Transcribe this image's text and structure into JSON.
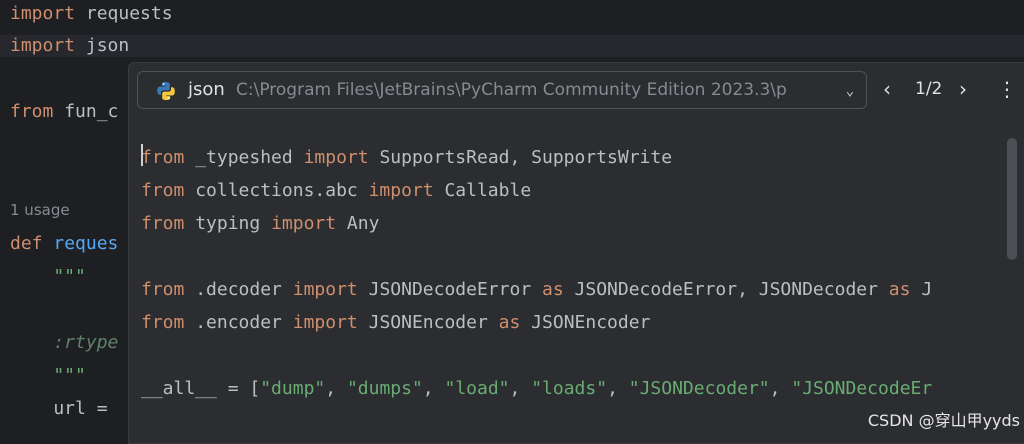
{
  "editor": {
    "lines": {
      "import_requests": [
        "import",
        " requests"
      ],
      "import_json": [
        "import",
        " json"
      ],
      "from_fun": [
        "from",
        " fun_c"
      ],
      "usage_hint": "1 usage",
      "def_line": [
        "def",
        " ",
        "reques"
      ],
      "doc_open": "    \"\"\"",
      "rtype": "    :rtype",
      "doc_close": "    \"\"\"",
      "url": "    url ="
    }
  },
  "popup": {
    "module_name": "json",
    "module_path": "C:\\Program Files\\JetBrains\\PyCharm Community Edition 2023.3\\p",
    "page_indicator": "1/2",
    "icons": {
      "module": "python-icon",
      "dropdown": "chevron-down-icon",
      "prev": "chevron-left-icon",
      "next": "chevron-right-icon",
      "more": "more-vertical-icon"
    },
    "code": {
      "l1": [
        "from",
        " _typeshed ",
        "import",
        " SupportsRead, SupportsWrite"
      ],
      "l2": [
        "from",
        " collections.abc ",
        "import",
        " Callable"
      ],
      "l3": [
        "from",
        " typing ",
        "import",
        " Any"
      ],
      "l4": [
        "from",
        " .decoder ",
        "import",
        " JSONDecodeError ",
        "as",
        " JSONDecodeError, JSONDecoder ",
        "as",
        " J"
      ],
      "l5": [
        "from",
        " .encoder ",
        "import",
        " JSONEncoder ",
        "as",
        " JSONEncoder"
      ],
      "l6": [
        "__all__ = [",
        "\"dump\"",
        ", ",
        "\"dumps\"",
        ", ",
        "\"load\"",
        ", ",
        "\"loads\"",
        ", ",
        "\"JSONDecoder\"",
        ", ",
        "\"JSONDecodeEr"
      ]
    }
  },
  "watermark": "CSDN @穿山甲yyds",
  "colors": {
    "background": "#1e1f22",
    "popup_background": "#2b2d30",
    "keyword": "#cf8e6d",
    "function": "#56a8f5",
    "string": "#6aab73",
    "text": "#bcbec4"
  }
}
